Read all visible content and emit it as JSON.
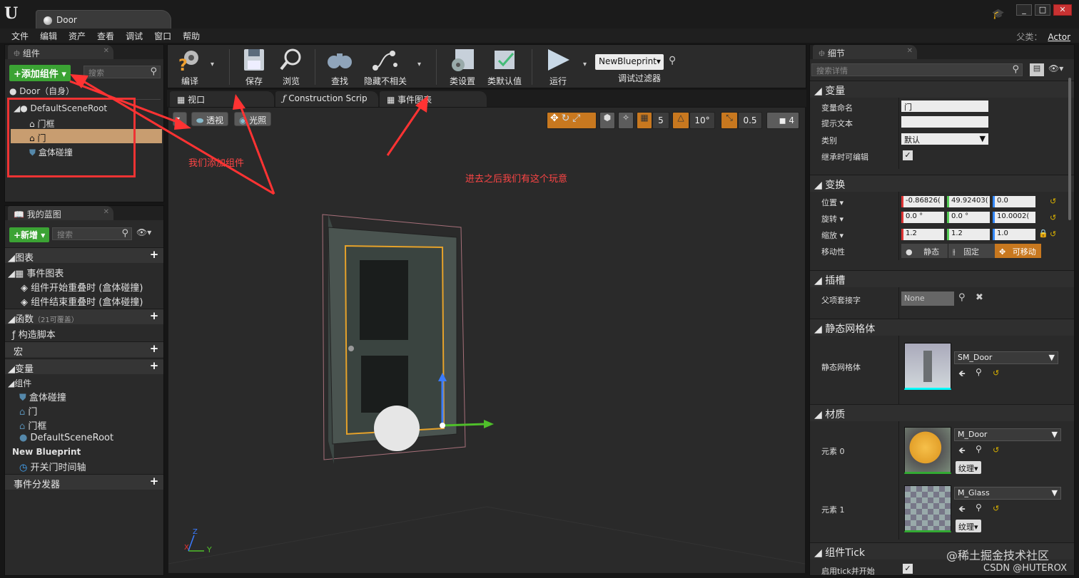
{
  "window": {
    "doc_tab": "Door",
    "parent_class_label": "父类：",
    "parent_class_value": "Actor"
  },
  "menu": [
    "文件",
    "编辑",
    "资产",
    "查看",
    "调试",
    "窗口",
    "帮助"
  ],
  "components_panel": {
    "tab": "组件",
    "add_button": "+添加组件",
    "search_placeholder": "搜索",
    "self_row": "Door（自身）",
    "tree": [
      "DefaultSceneRoot",
      "门框",
      "门",
      "盒体碰撞"
    ]
  },
  "my_blueprint": {
    "tab": "我的蓝图",
    "new_button": "+新增",
    "search_placeholder": "搜索",
    "graphs_header": "图表",
    "event_graph": "事件图表",
    "event_items": [
      "组件开始重叠时 (盒体碰撞)",
      "组件结束重叠时 (盒体碰撞)"
    ],
    "functions_header": "函数",
    "functions_note": "（21可覆盖）",
    "construction_script": "构造脚本",
    "macros_header": "宏",
    "variables_header": "变量",
    "components_subheader": "组件",
    "component_vars": [
      "盒体碰撞",
      "门",
      "门框",
      "DefaultSceneRoot"
    ],
    "new_blueprint_header": "New Blueprint",
    "timeline_item": "开关门时间轴",
    "dispatchers_header": "事件分发器"
  },
  "toolbar": {
    "compile": "编译",
    "save": "保存",
    "browse": "浏览",
    "find": "查找",
    "hide_unrelated": "隐藏不相关",
    "class_settings": "类设置",
    "class_defaults": "类默认值",
    "run": "运行",
    "debug_object": "NewBlueprint▾",
    "debug_filter": "调试过滤器"
  },
  "editor_tabs": [
    "视口",
    "Construction Scrip",
    "事件图表"
  ],
  "viewport": {
    "perspective": "透视",
    "lit": "光照",
    "grid_snap": "5",
    "rot_snap": "10°",
    "scale_snap": "0.5",
    "cam_speed": "4",
    "axis_x": "X",
    "axis_y": "Y",
    "axis_z": "Z"
  },
  "annotations": {
    "add_component": "我们添加组件",
    "event_graph_note": "进去之后我们有这个玩意"
  },
  "details": {
    "tab": "细节",
    "search_placeholder": "搜索详情",
    "variable_section": "变量",
    "var_name_label": "变量命名",
    "var_name_value": "门",
    "tooltip_label": "提示文本",
    "tooltip_value": "",
    "category_label": "类别",
    "category_value": "默认",
    "editable_label": "继承时可编辑",
    "transform_section": "变换",
    "location_label": "位置 ▾",
    "location": [
      "-0.86826(",
      "49.92403(",
      "0.0"
    ],
    "rotation_label": "旋转 ▾",
    "rotation": [
      "0.0 °",
      "0.0 °",
      "10.0002("
    ],
    "scale_label": "缩放 ▾",
    "scale": [
      "1.2",
      "1.2",
      "1.0"
    ],
    "mobility_label": "移动性",
    "mobility": [
      "静态",
      "固定",
      "可移动"
    ],
    "sockets_section": "插槽",
    "parent_socket_label": "父项套接字",
    "parent_socket_value": "None",
    "static_mesh_section": "静态网格体",
    "static_mesh_label": "静态网格体",
    "static_mesh_value": "SM_Door",
    "materials_section": "材质",
    "element0_label": "元素 0",
    "element0_value": "M_Door",
    "element1_label": "元素 1",
    "element1_value": "M_Glass",
    "texture_btn": "纹理▾",
    "tick_section": "组件Tick",
    "tick_start_label": "启用tick并开始"
  },
  "watermark": {
    "line1": "@稀土掘金技术社区",
    "line2": "CSDN @HUTEROX"
  }
}
